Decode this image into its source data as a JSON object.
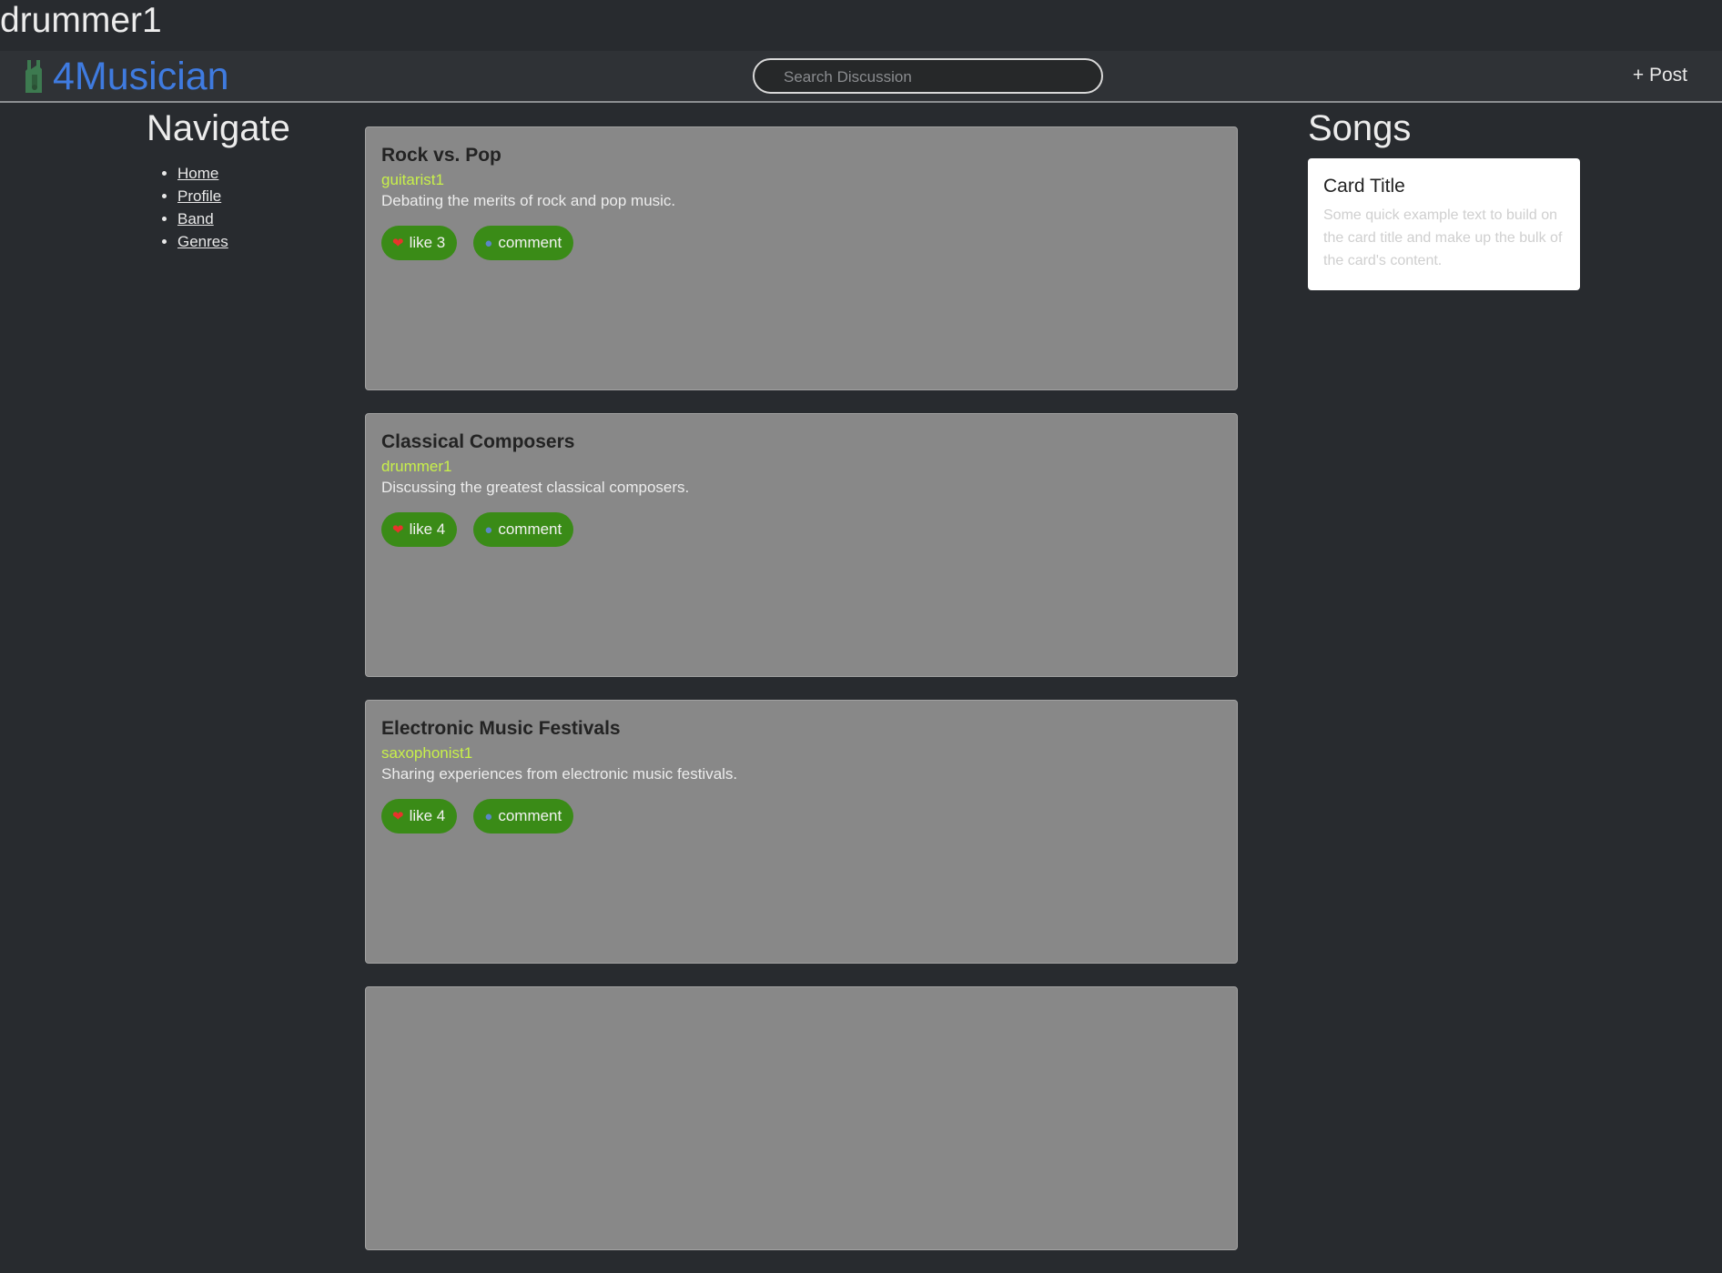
{
  "user": {
    "name": "drummer1"
  },
  "navbar": {
    "brand": "4Musician",
    "search_placeholder": "Search Discussion",
    "post_label": "+ Post"
  },
  "navigate": {
    "title": "Navigate",
    "items": [
      "Home",
      "Profile",
      "Band",
      "Genres"
    ]
  },
  "posts": [
    {
      "title": "Rock vs. Pop",
      "author": "guitarist1",
      "description": "Debating the merits of rock and pop music.",
      "like_label": "like 3",
      "comment_label": "comment"
    },
    {
      "title": "Classical Composers",
      "author": "drummer1",
      "description": "Discussing the greatest classical composers.",
      "like_label": "like 4",
      "comment_label": "comment"
    },
    {
      "title": "Electronic Music Festivals",
      "author": "saxophonist1",
      "description": "Sharing experiences from electronic music festivals.",
      "like_label": "like 4",
      "comment_label": "comment"
    }
  ],
  "songs": {
    "title": "Songs",
    "card_title": "Card Title",
    "card_text": "Some quick example text to build on the card title and make up the bulk of the card's content."
  },
  "colors": {
    "brand": "#3f7be0",
    "author": "#c8f04a",
    "pill": "#3a8b17",
    "card_bg": "#888888",
    "page_bg": "#282b2f"
  },
  "icons": {
    "brand": "guitar-icon",
    "like": "heart-icon",
    "comment": "speech-bubble-icon"
  }
}
